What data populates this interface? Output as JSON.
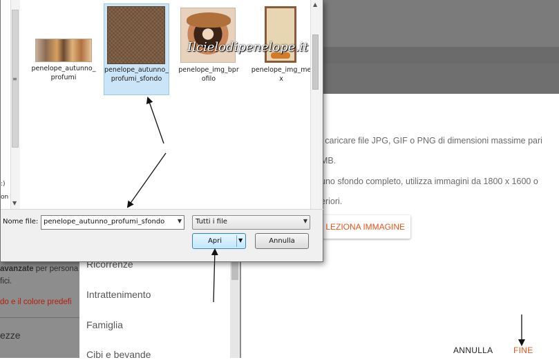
{
  "file_dialog": {
    "nav_partial_labels": [
      ":)",
      "on"
    ],
    "files": [
      {
        "name": "penelope_autunno_profumi",
        "selected": false
      },
      {
        "name": "penelope_autunno_profumi_sfondo",
        "selected": true
      },
      {
        "name": "penelope_img_bprofilo",
        "selected": false
      },
      {
        "name": "penelope_img_mex",
        "selected": false
      }
    ],
    "watermark": "Ilcielodipenelope.it",
    "filename_label": "Nome file:",
    "filename_value": "penelope_autunno_profumi_sfondo",
    "filter_value": "Tutti i file",
    "open_label": "Apri",
    "cancel_label": "Annulla"
  },
  "background_left": {
    "advanced_bold": "avanzate",
    "advanced_rest": " per persona",
    "advanced_line2": "fici.",
    "red_text": "do e il colore predefi",
    "item": "ezze"
  },
  "categories": {
    "items": [
      "Ricorrenze",
      "Intrattenimento",
      "Famiglia",
      "Cibi e bevande"
    ]
  },
  "upload_dialog": {
    "lines": [
      "i caricare file JPG, GIF o PNG di dimensioni massime pari",
      "MB.",
      "uno sfondo completo, utilizza immagini da 1800 x 1600 o",
      "eriori."
    ],
    "select_button": "LEZIONA IMMAGINE",
    "cancel": "ANNULLA",
    "done": "FINE"
  },
  "colors": {
    "accent": "#e8531a",
    "red_link": "#b81c0c",
    "selection": "#cce4f7"
  }
}
